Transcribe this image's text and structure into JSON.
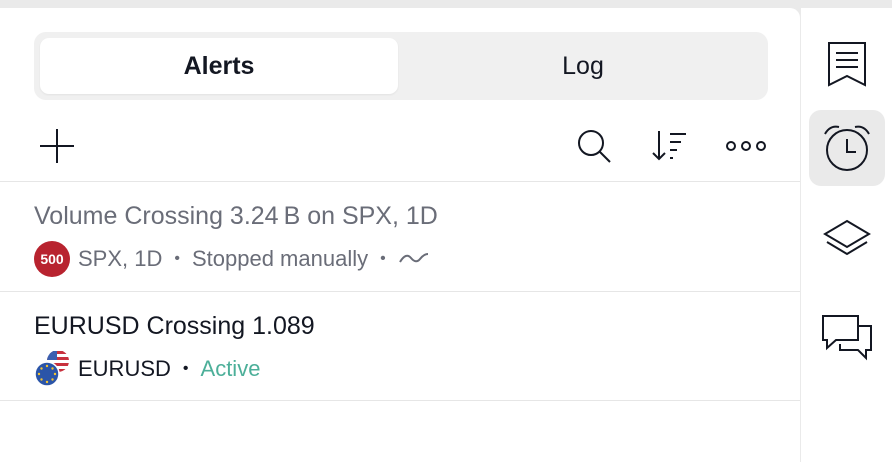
{
  "tabs": [
    {
      "label": "Alerts",
      "active": true
    },
    {
      "label": "Log",
      "active": false
    }
  ],
  "toolbar": {
    "icons": [
      "plus-icon",
      "search-icon",
      "sort-icon",
      "more-icon"
    ]
  },
  "alerts": [
    {
      "title": "Volume Crossing 3.24 B on SPX, 1D",
      "symbol_badge": "500",
      "symbol": "SPX, 1D",
      "status": "Stopped manually",
      "status_color": "#6a6d78",
      "trend_icon": "wave-icon"
    },
    {
      "title": "EURUSD Crossing 1.089",
      "symbol": "EURUSD",
      "status": "Active",
      "status_color": "#4caf99"
    }
  ],
  "right_sidebar": {
    "items": [
      "watchlist-icon",
      "alarm-clock-icon",
      "layers-icon",
      "chat-icon"
    ],
    "active": "alarm-clock-icon"
  }
}
